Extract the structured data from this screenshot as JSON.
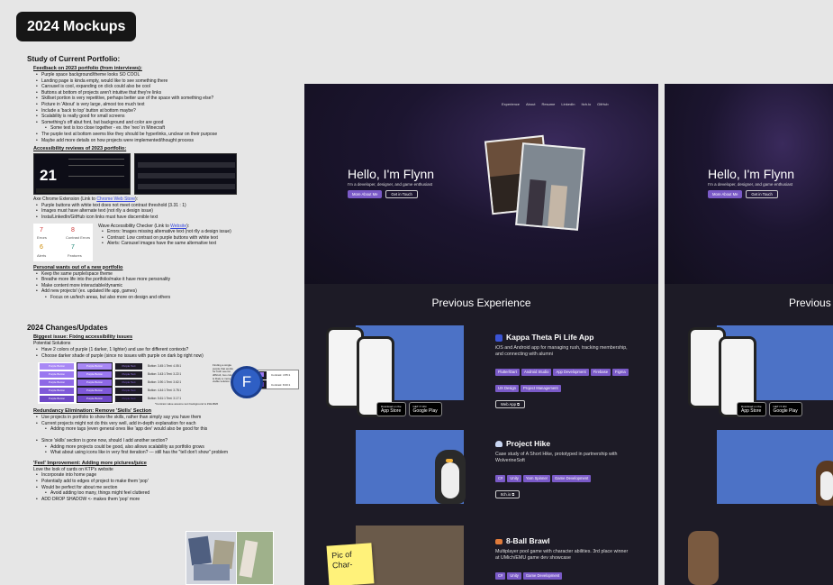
{
  "page_title": "2024 Mockups",
  "study": {
    "heading": "Study of Current Portfolio:",
    "feedback_heading": "Feedback on 2023 portfolio (from interviews):",
    "feedback": [
      "Purple space background/theme looks SO COOL",
      "Landing page is kinda empty, would like to see something there",
      "Carousel is cool, expanding on click could also be cool",
      "Buttons at bottom of projects aren't intuitive that they're links",
      "Skillset portion is very repetitive, perhaps better use of the space with something else?",
      "Picture in 'About' is very large, almost too much text",
      "Include a 'back to top' button at bottom maybe?",
      "Scalability is really good for small screens",
      "Something's off abut font, but background and color are good",
      "Some text is too close together - ex. the 'neo' in Minecraft",
      "The purple text at bottom seems like they should be hyperlinks, unclear on their purpose",
      "Maybe add more details on how projects were implemented/thought process"
    ],
    "a11y_heading": "Accessibility reviews of 2023 portfolio:",
    "axe_line_pre": "Axe Chrome Extension (Link to ",
    "axe_link": "Chrome Web Store",
    "axe_line_post": "):",
    "axe_items": [
      "Purple buttons with white text does not meet contrast threshold (3.31 : 1)",
      "Images must have alternate text (not rlly a design issue)",
      "Insta/LinkedIn/GitHub icon links must have discernible text"
    ],
    "wave_pre": "Wave Accessibility Checker (Link to ",
    "wave_link": "Website",
    "wave_post": "):",
    "wave_items": [
      "Errors: Images missing alternative text (not rlly a design issue)",
      "Contrast: Low contrast on purple buttons with white text",
      "Alerts: Carousel images have the same alternative text"
    ],
    "wave_counts": {
      "errors": "7",
      "contrast": "8",
      "alerts": "6",
      "features": "7",
      "errors_label": "Errors",
      "contrast_label": "Contrast Errors",
      "alerts_label": "Alerts",
      "features_label": "Features"
    },
    "axe_score": "21",
    "personal_heading": "Personal wants out of a new portfolio",
    "personal": [
      "Keep the same purple/space theme",
      "Breathe more life into the portfolio/make it have more personality",
      "Make content more interactable/dynamic",
      "Add new projects! (ex. updated life app, games)",
      "Focus on ux/tech areas, but also more on design and others"
    ]
  },
  "changes": {
    "heading": "2024 Changes/Updates",
    "biggest_heading": "Biggest issue: Fixing accessibility issues",
    "potential": "Potential Solutions",
    "biggest": [
      "Have 2 colors of purple (1 darker, 1 lighter) and use for different contexts?",
      "Choose darker shade of purple (since no issues with purple on dark bg right now)"
    ],
    "button_label": "Purple Button",
    "purple_text": "Purple Text",
    "contrast_rows": [
      "Button: 3.45:1  Text: 4.05:1",
      "Button: 3.43:1  Text: 3.22:1",
      "Button: 3.90:1  Text: 3.62:1",
      "Button: 4.44:1  Text: 3.78:1",
      "Button: 5.61:1  Text: 3.17:1"
    ],
    "contrast_note": "Finding a single purple that works for both seems difficult, two colors is likely a more viable solution",
    "light_purple": "Light Purple",
    "dark_purple": "Dark Purple",
    "light_contrast": "Contrast: 4.55:1",
    "dark_contrast": "Contrast: 8.00:1",
    "footnote": "*Contrast value assume text background is #1E1B26",
    "redundancy_heading": "Redundancy Elimination: Remove 'Skills' Section",
    "redundancy": [
      "Use projects in portfolio to show the skills, rather than simply say you have them",
      "Current projects might not do this very well, add in-depth explanation for each",
      "Adding more tags (even general ones like 'app dev' would also be good for this"
    ],
    "since": [
      "Since 'skills' section is gone now, should I add another section?",
      "Adding more projects could be good, also allows scalability as portfolio grows",
      "What about using icons like in very first iteration? --- still has the \"tell don't show\" problem"
    ],
    "feel_heading": "'Feel' Improvement: Adding more pictures/juice",
    "feel_intro": "Love the look of cards on KTP's website",
    "feel": [
      "Incorporate into home page",
      "Potentially add to edges of project to make them 'pop'",
      "Would be perfect for about me section",
      "Avoid adding too many, things might feel cluttered",
      "ADD DROP SHADOW <- makes them 'pop' more"
    ],
    "avatar_letter": "F"
  },
  "mockup": {
    "nav": [
      "Experience",
      "About",
      "Resume",
      "LinkedIn",
      "Itch.io",
      "GitHub"
    ],
    "hero_title": "Hello, I'm Flynn",
    "hero_sub": "I'm a developer, designer, and game enthusiast",
    "about_btn": "More About Me",
    "contact_btn": "Get in Touch",
    "section_title": "Previous Experience",
    "projects": [
      {
        "title": "Kappa Theta Pi Life App",
        "desc": "iOS and Android app for managing rush, tracking membership, and connecting with alumni",
        "tags": [
          "Flutter/Dart",
          "Android Studio",
          "App Development",
          "Firebase",
          "Figma",
          "UX Design",
          "Project Management"
        ],
        "link": "Web App ⧉"
      },
      {
        "title": "Project Hike",
        "desc": "Case study of A Short Hike, prototyped in partnership with WolverineSoft",
        "tags": [
          "C#",
          "Unity",
          "Yarn Spinner",
          "Game Development"
        ],
        "link": "Itch.io ⧉"
      },
      {
        "title": "8-Ball Brawl",
        "desc": "Multiplayer pool game with character abilities. 3rd place winner at UMich/EMU game dev showcase",
        "tags": [
          "C#",
          "Unity",
          "Game Development"
        ],
        "link": ""
      }
    ],
    "app_store": "App Store",
    "google_play": "Google Play",
    "app_store_small": "Download on the",
    "google_play_small": "GET IT ON",
    "sticky": "Pic of Char-"
  },
  "mockup2": {
    "hero_title": "Hello, I'm Flynn",
    "hero_sub": "I'm a developer, designer, and game enthusiast",
    "about_btn": "More About Me",
    "contact_btn": "Get in Touch",
    "section_title": "Previous"
  },
  "colors": {
    "accent": "#7a5ac7",
    "avatar": "#2f5fc4",
    "sticky": "#fff27a",
    "project_img": "#4c72c6"
  }
}
